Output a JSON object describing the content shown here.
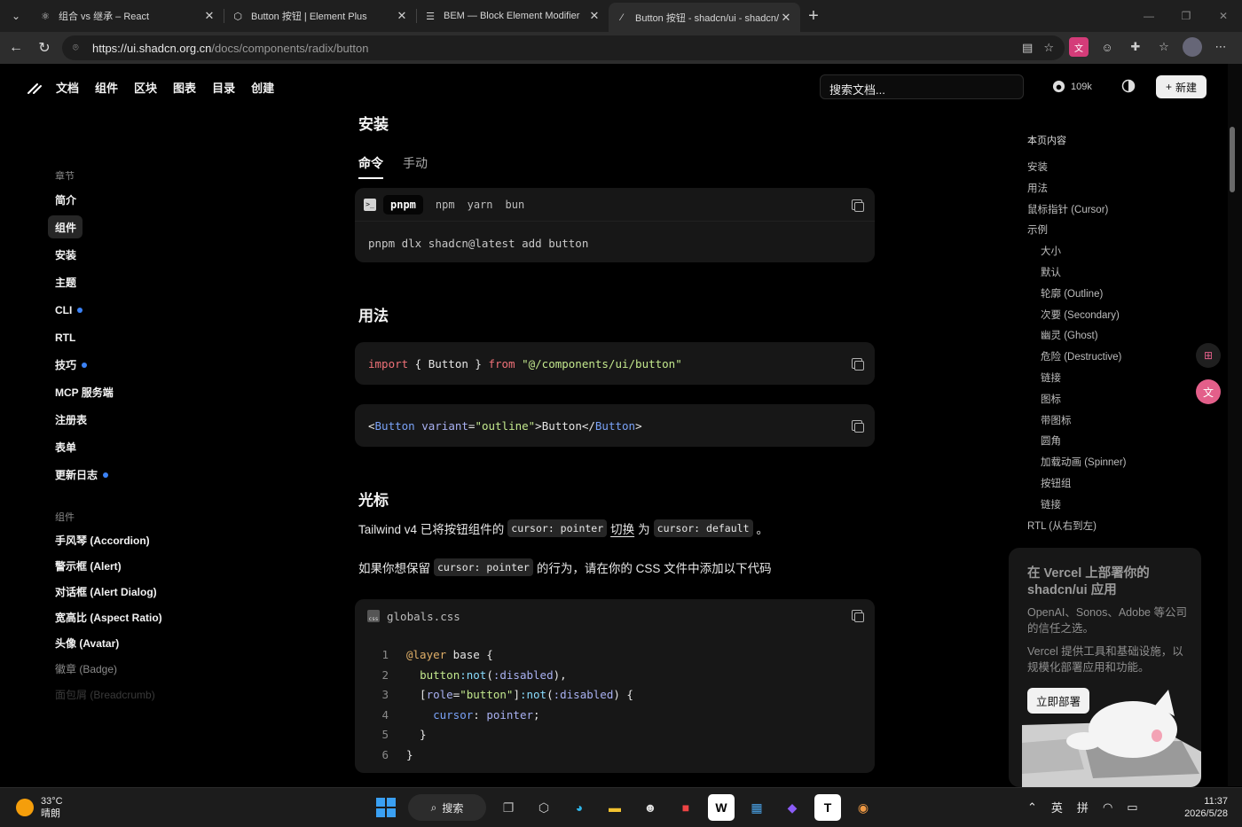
{
  "browser": {
    "tabs": [
      {
        "title": "组合 vs 继承 – React",
        "icon": "react-icon",
        "active": false
      },
      {
        "title": "Button 按钮 | Element Plus",
        "icon": "element-plus-icon",
        "active": false
      },
      {
        "title": "BEM — Block Element Modifier",
        "icon": "bem-icon",
        "active": false
      },
      {
        "title": "Button 按钮 - shadcn/ui - shadcn/ui",
        "icon": "shadcn-icon",
        "active": true
      }
    ],
    "url_host": "https://ui.shadcn.org.cn",
    "url_path": "/docs/components/radix/button"
  },
  "header": {
    "nav": [
      "文档",
      "组件",
      "区块",
      "图表",
      "目录",
      "创建"
    ],
    "search_placeholder": "搜索文档...",
    "github_stars": "109k",
    "new_button": "新建"
  },
  "sidebar": {
    "section1": "章节",
    "items1": [
      {
        "label": "简介",
        "dot": false,
        "active": false
      },
      {
        "label": "组件",
        "dot": false,
        "active": true
      },
      {
        "label": "安装",
        "dot": false,
        "active": false
      },
      {
        "label": "主题",
        "dot": false,
        "active": false
      },
      {
        "label": "CLI",
        "dot": true,
        "active": false
      },
      {
        "label": "RTL",
        "dot": false,
        "active": false
      },
      {
        "label": "技巧",
        "dot": true,
        "active": false
      },
      {
        "label": "MCP 服务端",
        "dot": false,
        "active": false
      },
      {
        "label": "注册表",
        "dot": false,
        "active": false
      },
      {
        "label": "表单",
        "dot": false,
        "active": false
      },
      {
        "label": "更新日志",
        "dot": true,
        "active": false
      }
    ],
    "section2": "组件",
    "items2": [
      "手风琴 (Accordion)",
      "警示框 (Alert)",
      "对话框 (Alert Dialog)",
      "宽高比 (Aspect Ratio)",
      "头像 (Avatar)",
      "徽章 (Badge)",
      "面包屑 (Breadcrumb)"
    ]
  },
  "content": {
    "install_title": "安装",
    "tabs": [
      "命令",
      "手动"
    ],
    "package_managers": [
      "pnpm",
      "npm",
      "yarn",
      "bun"
    ],
    "install_command": "pnpm dlx shadcn@latest add button",
    "usage_title": "用法",
    "usage_import": {
      "kw": "import",
      "mid": " { Button } ",
      "from": "from",
      "str": " \"@/components/ui/button\""
    },
    "usage_jsx": {
      "open": "<",
      "tag": "Button",
      "attr": " variant",
      "eq": "=",
      "str": "\"outline\"",
      "close": ">Button</",
      "tag2": "Button",
      "end": ">"
    },
    "cursor_title": "光标",
    "cursor_p1": {
      "a": "Tailwind v4 已将按钮组件的",
      "code1": "cursor: pointer",
      "link": "切换",
      "b": "为",
      "code2": "cursor: default",
      "c": "。"
    },
    "cursor_p2": {
      "a": "如果你想保留",
      "code": "cursor: pointer",
      "b": "的行为，请在你的 CSS 文件中添加以下代码"
    },
    "file_name": "globals.css",
    "css_lines": [
      {
        "n": "1",
        "html": "<span class='k-gold'>@layer</span> base {"
      },
      {
        "n": "2",
        "html": "  <span class='k-str'>button</span><span class='k-cyan'>:not</span>(<span class='k-lav'>:disabled</span>),"
      },
      {
        "n": "3",
        "html": "  [<span class='k-lav'>role</span>=<span class='k-str'>\"button\"</span>]<span class='k-cyan'>:not</span>(<span class='k-lav'>:disabled</span>) {"
      },
      {
        "n": "4",
        "html": "    <span class='k-blue'>cursor</span>: <span class='k-lav'>pointer</span>;"
      },
      {
        "n": "5",
        "html": "  }"
      },
      {
        "n": "6",
        "html": "}"
      }
    ]
  },
  "toc": {
    "head": "本页内容",
    "items": [
      {
        "label": "安装",
        "sub": false
      },
      {
        "label": "用法",
        "sub": false
      },
      {
        "label": "鼠标指针 (Cursor)",
        "sub": false
      },
      {
        "label": "示例",
        "sub": false
      },
      {
        "label": "大小",
        "sub": true
      },
      {
        "label": "默认",
        "sub": true
      },
      {
        "label": "轮廓 (Outline)",
        "sub": true
      },
      {
        "label": "次要 (Secondary)",
        "sub": true
      },
      {
        "label": "幽灵 (Ghost)",
        "sub": true
      },
      {
        "label": "危险 (Destructive)",
        "sub": true
      },
      {
        "label": "链接",
        "sub": true
      },
      {
        "label": "图标",
        "sub": true
      },
      {
        "label": "带图标",
        "sub": true
      },
      {
        "label": "圆角",
        "sub": true
      },
      {
        "label": "加载动画 (Spinner)",
        "sub": true
      },
      {
        "label": "按钮组",
        "sub": true
      },
      {
        "label": "链接",
        "sub": true
      },
      {
        "label": "RTL (从右到左)",
        "sub": false
      }
    ]
  },
  "promo": {
    "title": "在 Vercel 上部署你的 shadcn/ui 应用",
    "p1": "OpenAI、Sonos、Adobe 等公司的信任之选。",
    "p2": "Vercel 提供工具和基础设施，以规模化部署应用和功能。",
    "button": "立即部署"
  },
  "taskbar": {
    "temp": "33°C",
    "weather": "晴朗",
    "search": "搜索",
    "ime1": "英",
    "ime2": "拼",
    "time": "11:37",
    "date": "2026/5/28"
  }
}
